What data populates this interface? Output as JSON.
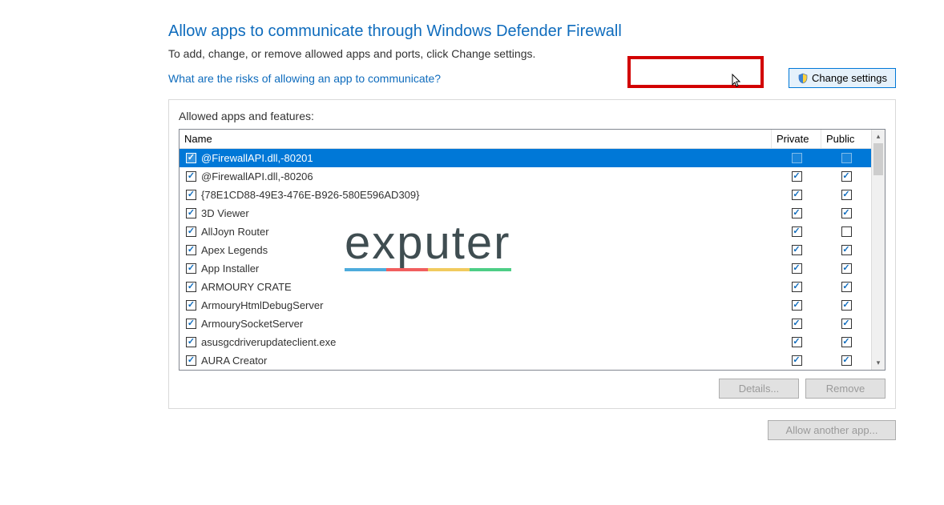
{
  "title": "Allow apps to communicate through Windows Defender Firewall",
  "subtitle": "To add, change, or remove allowed apps and ports, click Change settings.",
  "risk_link": "What are the risks of allowing an app to communicate?",
  "change_settings_label": "Change settings",
  "group_label": "Allowed apps and features:",
  "columns": {
    "name": "Name",
    "private": "Private",
    "public": "Public"
  },
  "rows": [
    {
      "name": "@FirewallAPI.dll,-80201",
      "enabled": true,
      "private": false,
      "public": false,
      "selected": true
    },
    {
      "name": "@FirewallAPI.dll,-80206",
      "enabled": true,
      "private": true,
      "public": true
    },
    {
      "name": "{78E1CD88-49E3-476E-B926-580E596AD309}",
      "enabled": true,
      "private": true,
      "public": true
    },
    {
      "name": "3D Viewer",
      "enabled": true,
      "private": true,
      "public": true
    },
    {
      "name": "AllJoyn Router",
      "enabled": true,
      "private": true,
      "public": false
    },
    {
      "name": "Apex Legends",
      "enabled": true,
      "private": true,
      "public": true
    },
    {
      "name": "App Installer",
      "enabled": true,
      "private": true,
      "public": true
    },
    {
      "name": "ARMOURY CRATE",
      "enabled": true,
      "private": true,
      "public": true
    },
    {
      "name": "ArmouryHtmlDebugServer",
      "enabled": true,
      "private": true,
      "public": true
    },
    {
      "name": "ArmourySocketServer",
      "enabled": true,
      "private": true,
      "public": true
    },
    {
      "name": "asusgcdriverupdateclient.exe",
      "enabled": true,
      "private": true,
      "public": true
    },
    {
      "name": "AURA Creator",
      "enabled": true,
      "private": true,
      "public": true
    }
  ],
  "details_label": "Details...",
  "remove_label": "Remove",
  "allow_another_label": "Allow another app...",
  "watermark": "exputer"
}
